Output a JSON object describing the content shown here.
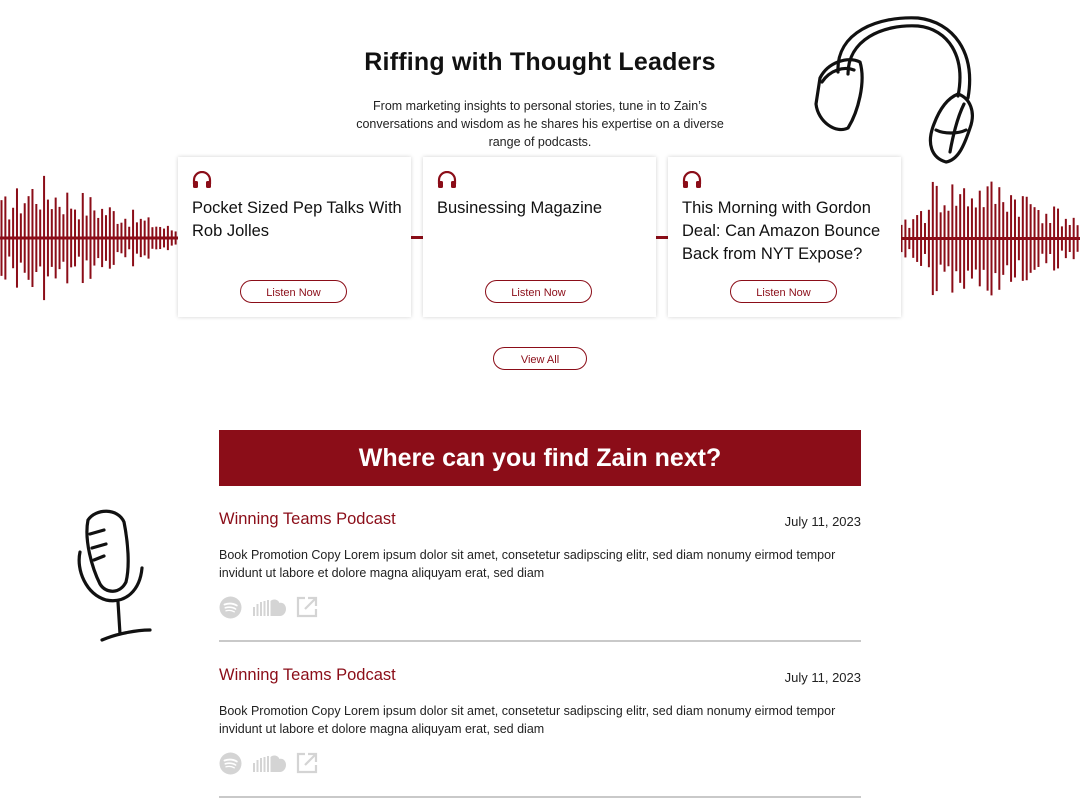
{
  "header": {
    "title": "Riffing with Thought Leaders",
    "subtitle": "From marketing insights to personal stories, tune in to Zain’s conversations and wisdom as he shares his expertise on a diverse range of podcasts."
  },
  "podcasts": [
    {
      "title": "Pocket Sized Pep Talks With Rob Jolles",
      "button": "Listen Now",
      "icon": "headphones-icon"
    },
    {
      "title": "Businessing Magazine",
      "button": "Listen Now",
      "icon": "headphones-icon"
    },
    {
      "title": "This Morning with Gordon Deal: Can Amazon Bounce Back from NYT Expose?",
      "button": "Listen Now",
      "icon": "headphones-icon"
    }
  ],
  "view_all_label": "View All",
  "banner": {
    "title": "Where can you find Zain next?"
  },
  "episodes": [
    {
      "title": "Winning Teams Podcast",
      "date": "July 11, 2023",
      "description": "Book Promotion Copy Lorem ipsum dolor sit amet, consetetur sadipscing elitr, sed diam nonumy eirmod tempor invidunt ut labore et dolore magna aliquyam erat, sed diam",
      "icons": [
        "spotify-icon",
        "soundcloud-icon",
        "external-link-icon"
      ]
    },
    {
      "title": "Winning Teams Podcast",
      "date": "July 11, 2023",
      "description": "Book Promotion Copy Lorem ipsum dolor sit amet, consetetur sadipscing elitr, sed diam nonumy eirmod tempor invidunt ut labore et dolore magna aliquyam erat, sed diam",
      "icons": [
        "spotify-icon",
        "soundcloud-icon",
        "external-link-icon"
      ]
    }
  ],
  "colors": {
    "accent": "#8b0d18",
    "icon_muted": "#d4d4d4",
    "divider": "#c9c9c9"
  }
}
